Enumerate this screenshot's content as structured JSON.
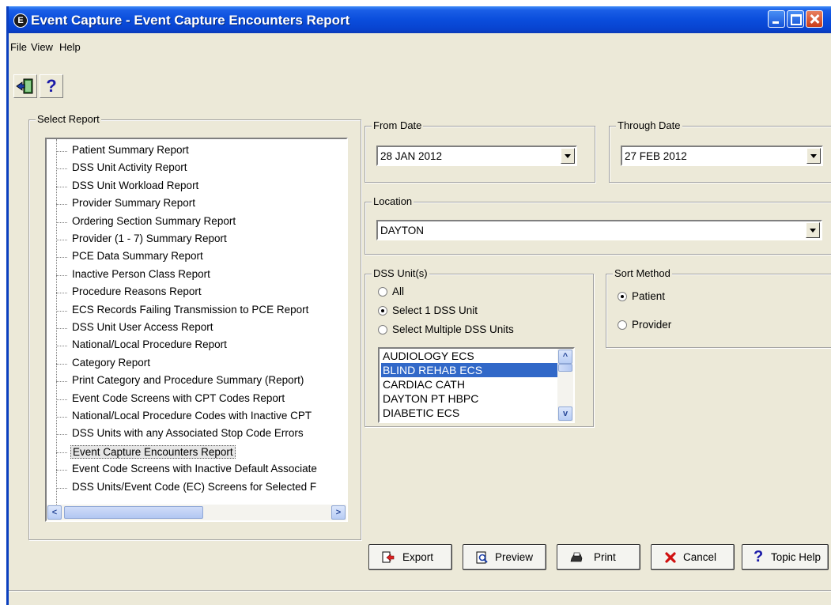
{
  "window": {
    "title": "Event Capture - Event Capture Encounters Report"
  },
  "menu": {
    "items": [
      "File",
      "View",
      "Help"
    ]
  },
  "toolbar": {
    "exit_icon": "exit-door-icon",
    "help_label": "?"
  },
  "select_report": {
    "label": "Select Report",
    "items": [
      "Patient Summary Report",
      "DSS Unit Activity Report",
      "DSS Unit Workload Report",
      "Provider Summary Report",
      "Ordering Section Summary Report",
      "Provider (1 - 7) Summary Report",
      "PCE Data Summary Report",
      "Inactive Person Class Report",
      "Procedure Reasons Report",
      "ECS Records Failing Transmission to PCE Report",
      "DSS Unit User Access Report",
      "National/Local Procedure Report",
      "Category Report",
      "Print Category and Procedure Summary (Report)",
      "Event Code Screens with CPT Codes Report",
      "National/Local Procedure Codes with Inactive CPT",
      "DSS Units with any Associated Stop Code Errors",
      "Event Capture Encounters Report",
      "Event Code Screens with Inactive Default Associate",
      "DSS Units/Event Code (EC) Screens for Selected F"
    ],
    "selected_index": 17
  },
  "from_date": {
    "label": "From Date",
    "value": "28 JAN 2012"
  },
  "through_date": {
    "label": "Through Date",
    "value": "27 FEB 2012"
  },
  "location": {
    "label": "Location",
    "value": "DAYTON"
  },
  "dss_units": {
    "label": "DSS Unit(s)",
    "options": [
      "All",
      "Select 1 DSS Unit",
      "Select Multiple DSS Units"
    ],
    "selected_option": 1,
    "list": [
      "AUDIOLOGY ECS",
      "BLIND REHAB ECS",
      "CARDIAC CATH",
      "DAYTON PT HBPC",
      "DIABETIC ECS"
    ],
    "selected_list_index": 1
  },
  "sort_method": {
    "label": "Sort Method",
    "options": [
      "Patient",
      "Provider"
    ],
    "selected_option": 0
  },
  "buttons": {
    "export": "Export",
    "preview": "Preview",
    "print": "Print",
    "cancel": "Cancel",
    "topic_help": "Topic Help"
  },
  "colors": {
    "title_bar": "#0a4ddc",
    "selection": "#3168c8",
    "dialog_bg": "#ece9d8"
  }
}
